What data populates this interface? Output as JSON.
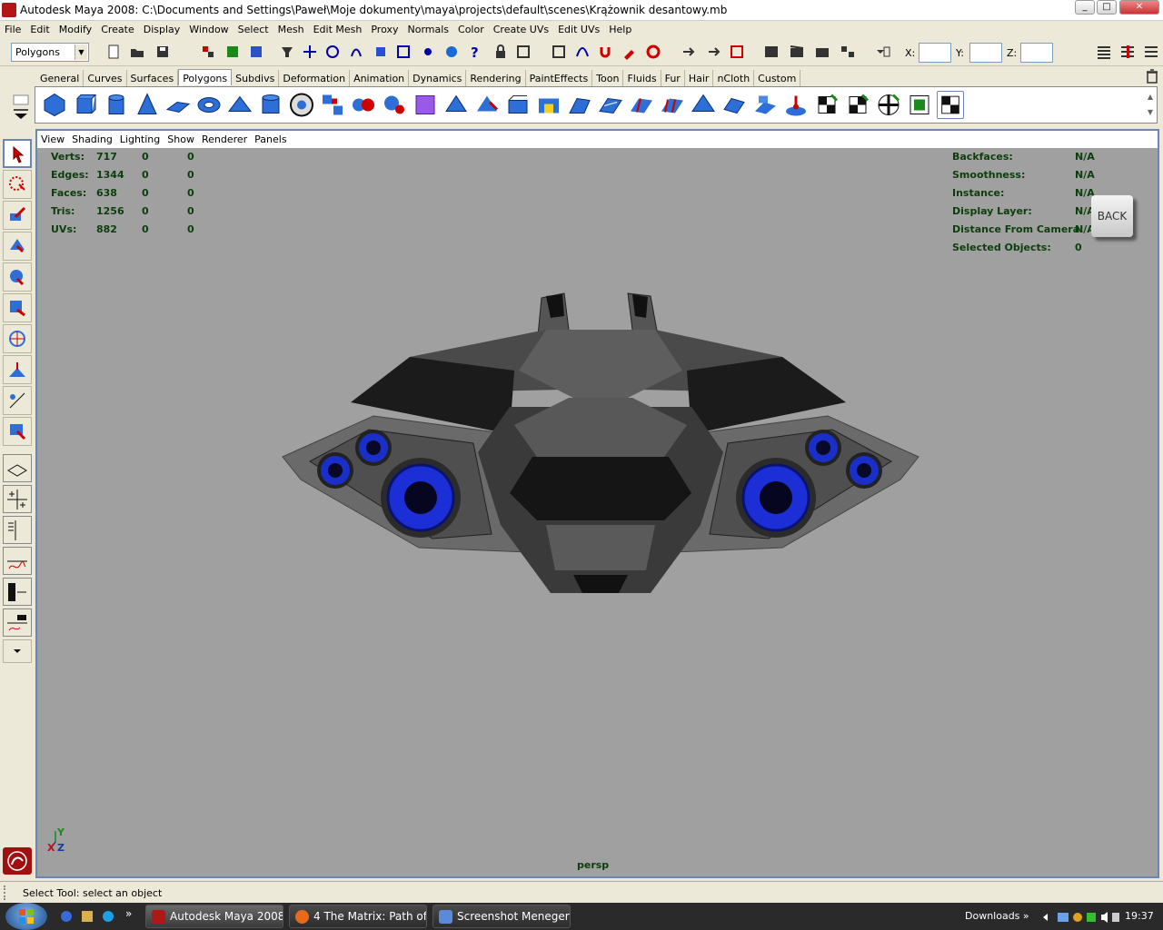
{
  "window": {
    "title": "Autodesk Maya 2008: C:\\Documents and Settings\\Paweł\\Moje dokumenty\\maya\\projects\\default\\scenes\\Krążownik desantowy.mb",
    "min": "_",
    "max": "□",
    "close": "✕"
  },
  "menubar": {
    "items": [
      "File",
      "Edit",
      "Modify",
      "Create",
      "Display",
      "Window",
      "Select",
      "Mesh",
      "Edit Mesh",
      "Proxy",
      "Normals",
      "Color",
      "Create UVs",
      "Edit UVs",
      "Help"
    ]
  },
  "statusline": {
    "mode": "Polygons",
    "x_label": "X:",
    "y_label": "Y:",
    "z_label": "Z:"
  },
  "shelf": {
    "tabs": [
      "General",
      "Curves",
      "Surfaces",
      "Polygons",
      "Subdivs",
      "Deformation",
      "Animation",
      "Dynamics",
      "Rendering",
      "PaintEffects",
      "Toon",
      "Fluids",
      "Fur",
      "Hair",
      "nCloth",
      "Custom"
    ],
    "active": "Polygons"
  },
  "panel": {
    "menu": [
      "View",
      "Shading",
      "Lighting",
      "Show",
      "Renderer",
      "Panels"
    ],
    "camera": "persp"
  },
  "hud_left": [
    {
      "label": "Verts:",
      "v1": "717",
      "v2": "0",
      "v3": "0"
    },
    {
      "label": "Edges:",
      "v1": "1344",
      "v2": "0",
      "v3": "0"
    },
    {
      "label": "Faces:",
      "v1": "638",
      "v2": "0",
      "v3": "0"
    },
    {
      "label": "Tris:",
      "v1": "1256",
      "v2": "0",
      "v3": "0"
    },
    {
      "label": "UVs:",
      "v1": "882",
      "v2": "0",
      "v3": "0"
    }
  ],
  "hud_right": [
    {
      "label": "Backfaces:",
      "value": "N/A"
    },
    {
      "label": "Smoothness:",
      "value": "N/A"
    },
    {
      "label": "Instance:",
      "value": "N/A"
    },
    {
      "label": "Display Layer:",
      "value": "N/A"
    },
    {
      "label": "Distance From Camera:",
      "value": "N/A"
    },
    {
      "label": "Selected Objects:",
      "value": "0"
    }
  ],
  "back_label": "BACK",
  "axis": {
    "y": "Y",
    "x": "X",
    "z": "Z"
  },
  "helpline": "Select Tool: select an object",
  "taskbar": {
    "tasks": [
      "Autodesk Maya 2008...",
      "4 The Matrix: Path of...",
      "Screenshot Meneger ..."
    ],
    "more": "»",
    "downloads": "Downloads",
    "downloads_more": "»",
    "clock": "19:37"
  }
}
